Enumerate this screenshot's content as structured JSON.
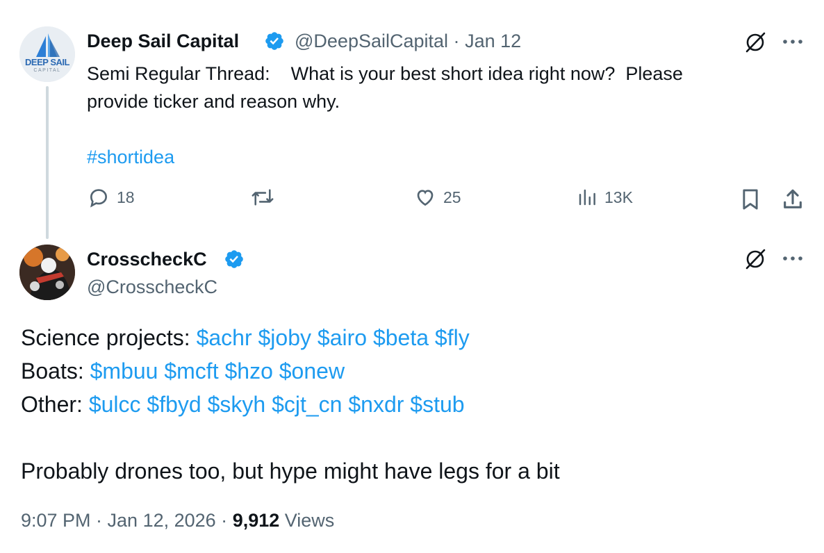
{
  "parent_tweet": {
    "avatar_text": "DEEP SAIL",
    "avatar_subtext": "CAPITAL",
    "name": "Deep Sail Capital",
    "handle": "@DeepSailCapital",
    "separator": "·",
    "date": "Jan 12",
    "text_line1": "Semi Regular Thread:    What is your best short idea right now?  Please",
    "text_line2": "provide ticker and reason why.",
    "hashtag": "#shortidea",
    "reply_count": "18",
    "like_count": "25",
    "view_count": "13K"
  },
  "reply_tweet": {
    "name": "CrosscheckC",
    "handle": "@CrosscheckC",
    "lines": [
      {
        "label": "Science projects: ",
        "tickers": "$achr $joby $airo $beta $fly"
      },
      {
        "label": "Boats: ",
        "tickers": "$mbuu $mcft $hzo $onew"
      },
      {
        "label": "Other: ",
        "tickers": "$ulcc $fbyd $skyh $cjt_cn $nxdr $stub"
      }
    ],
    "closing_text": "Probably drones too, but hype might have legs for a bit",
    "time": "9:07 PM · Jan 12, 2026 · ",
    "views_count": "9,912",
    "views_label": " Views"
  },
  "colors": {
    "link": "#1d9bf0",
    "verified": "#1d9bf0",
    "muted": "#536471",
    "text": "#0f1419"
  },
  "icons": [
    "verified-badge-icon",
    "grok-icon",
    "more-icon",
    "reply-icon",
    "retweet-icon",
    "like-icon",
    "views-icon",
    "bookmark-icon",
    "share-icon"
  ]
}
